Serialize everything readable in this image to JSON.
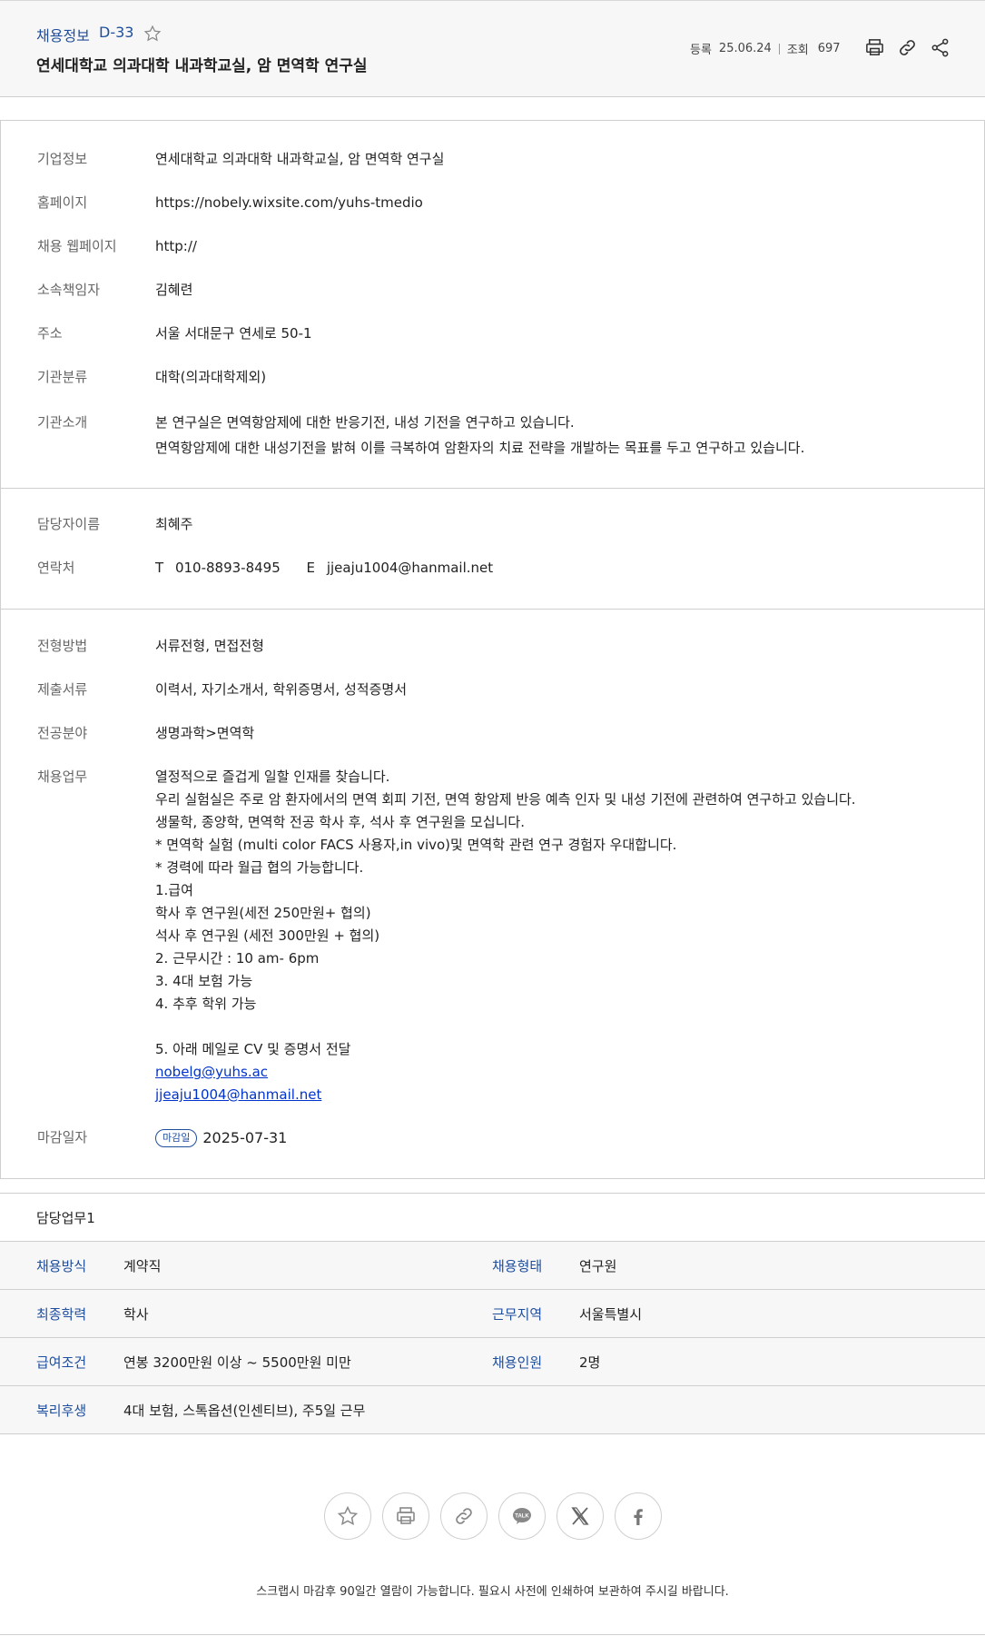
{
  "header": {
    "tag": "채용정보",
    "dday": "D-33",
    "title": "연세대학교 의과대학 내과학교실, 암 면역학 연구실",
    "registered_label": "등록",
    "registered_date": "25.06.24",
    "views_label": "조회",
    "views_count": "697",
    "icons": [
      "star-icon",
      "print-icon",
      "link-icon",
      "share-icon"
    ]
  },
  "company": {
    "info_label": "기업정보",
    "info_value": "연세대학교 의과대학 내과학교실, 암 면역학 연구실",
    "homepage_label": "홈페이지",
    "homepage_value": "https://nobely.wixsite.com/yuhs-tmedio",
    "recruit_page_label": "채용 웹페이지",
    "recruit_page_value": "http://",
    "manager_label": "소속책임자",
    "manager_value": "김혜련",
    "address_label": "주소",
    "address_value": "서울 서대문구 연세로 50-1",
    "category_label": "기관분류",
    "category_value": "대학(의과대학제외)",
    "intro_label": "기관소개",
    "intro_lines": [
      "본 연구실은 면역항암제에 대한 반응기전, 내성 기전을 연구하고 있습니다.",
      "면역항암제에 대한 내성기전을 밝혀 이를 극복하여 암환자의 치료 전략을 개발하는 목표를 두고 연구하고 있습니다."
    ]
  },
  "contact": {
    "name_label": "담당자이름",
    "name_value": "최혜주",
    "phone_label": "연락처",
    "tel_prefix": "T",
    "tel_value": "010-8893-8495",
    "email_prefix": "E",
    "email_value": "jjeaju1004@hanmail.net"
  },
  "recruit": {
    "method_label": "전형방법",
    "method_value": "서류전형, 면접전형",
    "docs_label": "제출서류",
    "docs_value": "이력서, 자기소개서, 학위증명서, 성적증명서",
    "major_label": "전공분야",
    "major_value": "생명과학>면역학",
    "duty_label": "채용업무",
    "duty_lines": [
      "열정적으로 즐겁게 일할 인재를 찾습니다.",
      "우리 실험실은 주로 암 환자에서의 면역 회피 기전, 면역 항암제 반응 예측 인자 및 내성 기전에 관련하여 연구하고 있습니다.",
      "생물학, 종양학, 면역학 전공 학사 후, 석사 후 연구원을 모십니다.",
      "* 면역학 실험 (multi color FACS 사용자,in vivo)및 면역학 관련 연구 경험자 우대합니다.",
      "* 경력에 따라 월급 협의 가능합니다.",
      "1.급여",
      "학사 후 연구원(세전 250만원+ 협의)",
      "석사 후 연구원 (세전 300만원 + 협의)",
      "2. 근무시간 : 10 am- 6pm",
      "3. 4대 보험 가능",
      "4. 추후 학위 가능",
      "",
      "5. 아래 메일로 CV 및 증명서 전달"
    ],
    "duty_link1": "nobelg@yuhs.ac",
    "duty_link2": "jjeaju1004@hanmail.net",
    "deadline_label": "마감일자",
    "deadline_badge": "마감일",
    "deadline_value": "2025-07-31"
  },
  "duty_section": {
    "title": "담당업무1",
    "rows": [
      {
        "label1": "채용방식",
        "value1": "계약직",
        "label2": "채용형태",
        "value2": "연구원"
      },
      {
        "label1": "최종학력",
        "value1": "학사",
        "label2": "근무지역",
        "value2": "서울특별시"
      },
      {
        "label1": "급여조건",
        "value1": "연봉 3200만원 이상 ~ 5500만원 미만",
        "label2": "채용인원",
        "value2": "2명"
      },
      {
        "label1": "복리후생",
        "value1": "4대 보험, 스톡옵션(인센티브), 주5일 근무",
        "label2": "",
        "value2": ""
      }
    ]
  },
  "share_buttons": [
    "star-icon",
    "print-icon",
    "link-icon",
    "kakaotalk-icon",
    "x-icon",
    "facebook-icon"
  ],
  "footer_note": "스크랩시 마감후 90일간 열람이 가능합니다. 필요시 사전에 인쇄하여 보관하여 주시길 바랍니다.",
  "colors": {
    "accent": "#1f4e9c",
    "link": "#0033cc",
    "panel_bg": "#f7f7f7",
    "border": "#cfcfcf"
  }
}
